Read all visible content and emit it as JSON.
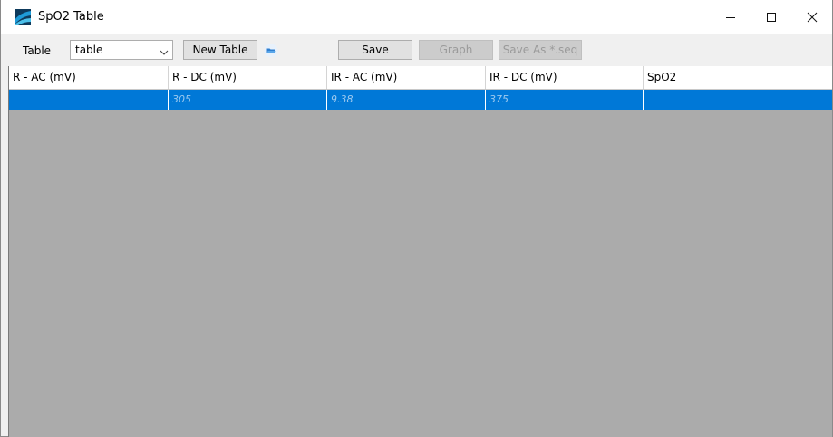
{
  "window": {
    "title": "SpO2 Table",
    "controls": [
      "minimize",
      "maximize",
      "close"
    ]
  },
  "toolbar": {
    "table_label": "Table",
    "table_select_value": "table",
    "new_table_label": "New Table",
    "save_label": "Save",
    "graph_label": "Graph",
    "save_as_label": "Save As *.seq"
  },
  "grid": {
    "columns": [
      "R - AC (mV)",
      "R - DC (mV)",
      "IR - AC (mV)",
      "IR - DC (mV)",
      "SpO2"
    ],
    "rows": [
      [
        "",
        "305",
        "9.38",
        "375",
        ""
      ]
    ],
    "selection_color": "#0078d7",
    "empty_area_color": "#ababab"
  },
  "icons": {
    "app": "app-logo-icon",
    "open": "folder-open-icon",
    "combo_arrow": "chevron-down-icon"
  }
}
